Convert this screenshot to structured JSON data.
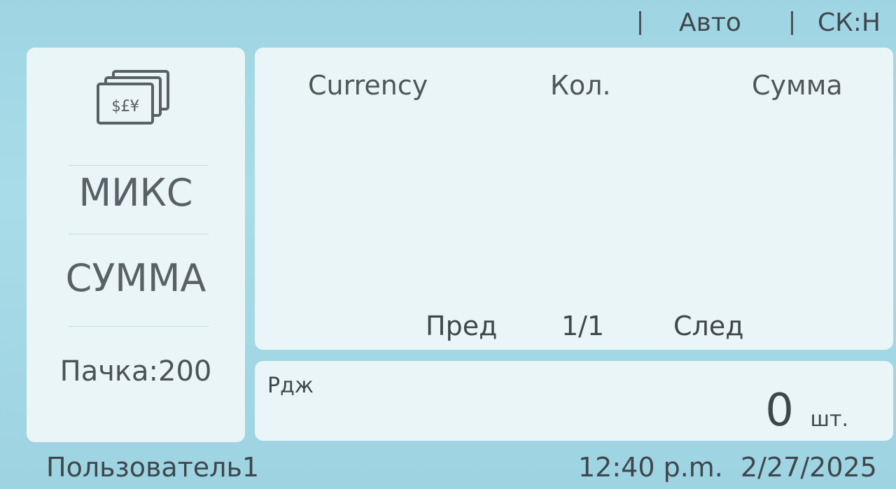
{
  "header": {
    "mode": "Авто",
    "counterfeit_status": "СК:Н"
  },
  "left_panel": {
    "icon": "currency-notes-icon",
    "mode_label": "МИКС",
    "count_mode_label": "СУММА",
    "batch_label": "Пачка:200"
  },
  "table": {
    "columns": [
      "Currency",
      "Кол.",
      "Сумма"
    ],
    "rows": []
  },
  "pagination": {
    "prev_label": "Пред",
    "page_indicator": "1/1",
    "next_label": "След"
  },
  "counter": {
    "reject_label": "Рдж",
    "count": "0",
    "unit": "шт."
  },
  "status_bar": {
    "user": "Пользователь1",
    "time": "12:40 p.m.",
    "date": "2/27/2025"
  }
}
